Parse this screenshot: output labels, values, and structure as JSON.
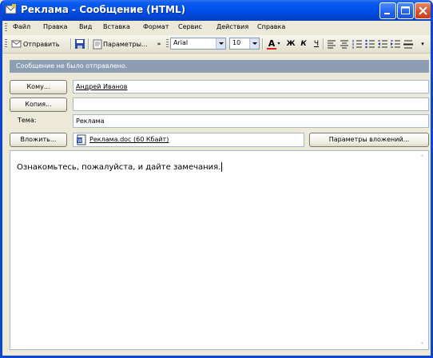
{
  "window": {
    "title": "Реклама - Сообщение (HTML)"
  },
  "menu": [
    "Файл",
    "Правка",
    "Вид",
    "Вставка",
    "Формат",
    "Сервис",
    "Действия",
    "Справка"
  ],
  "toolbar": {
    "send_label": "Отправить",
    "options_label": "Параметры...",
    "font_name": "Arial",
    "font_size": "10"
  },
  "info_bar": "Сообщение не было отправлено.",
  "address": {
    "to_button": "Кому...",
    "to_value": "Андрей Иванов",
    "cc_button": "Копия...",
    "cc_value": "",
    "subject_label": "Тема:",
    "subject_value": "Реклама",
    "attach_button": "Вложить...",
    "attachment": "Реклама.doc (60 Кбайт)",
    "attach_options_button": "Параметры вложений..."
  },
  "body": {
    "text": "Ознакомьтесь, пожалуйста, и дайте замечания."
  },
  "colors": {
    "title_bar": "#0050ea",
    "info_bar": "#8d9eb3",
    "font_color_accent": "#e0201a"
  }
}
